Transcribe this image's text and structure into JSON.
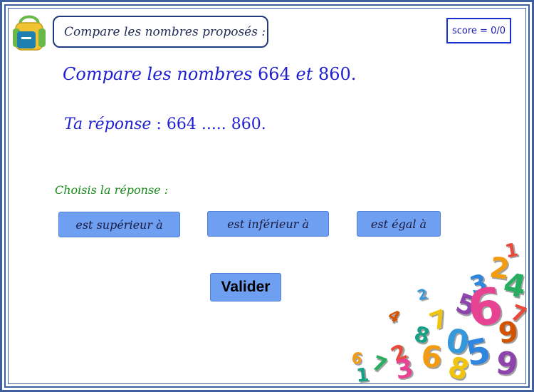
{
  "header": {
    "title": "Compare les nombres proposés :",
    "score": "score = 0/0"
  },
  "question": {
    "prefix": "Compare les nombres",
    "a": "664",
    "conj": "et",
    "b": "860",
    "suffix": "."
  },
  "answer": {
    "label": "Ta réponse",
    "colon": " :",
    "a": "664",
    "blank": ".....",
    "b": "860",
    "suffix": "."
  },
  "choices": {
    "label": "Choisis la réponse :",
    "options": [
      "est supérieur à",
      "est inférieur à",
      "est égal à"
    ]
  },
  "actions": {
    "validate_label": "Valider"
  },
  "decor": {
    "pile_digits": [
      "1",
      "2",
      "3",
      "4",
      "5",
      "6",
      "7",
      "8",
      "9",
      "0",
      "2",
      "6",
      "5",
      "7",
      "9",
      "3",
      "8",
      "1",
      "4",
      "2",
      "7",
      "6"
    ]
  },
  "colors": {
    "frame": "#3d5f9e",
    "text_blue": "#2020d0",
    "label_green": "#1a8a1a",
    "button": "#6f9ff0"
  }
}
